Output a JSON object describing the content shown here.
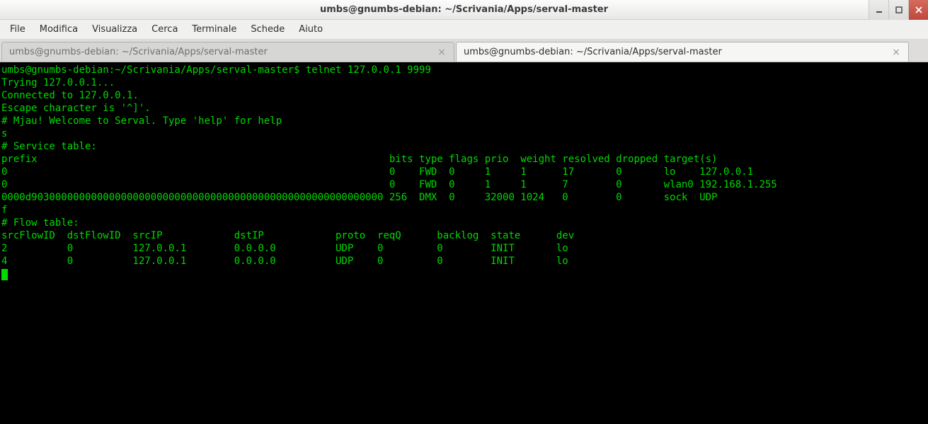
{
  "window": {
    "title": "umbs@gnumbs-debian: ~/Scrivania/Apps/serval-master"
  },
  "menu": {
    "file": "File",
    "edit": "Modifica",
    "view": "Visualizza",
    "search": "Cerca",
    "terminal": "Terminale",
    "tabs": "Schede",
    "help": "Aiuto"
  },
  "tabs": [
    {
      "label": "umbs@gnumbs-debian: ~/Scrivania/Apps/serval-master",
      "active": false
    },
    {
      "label": "umbs@gnumbs-debian: ~/Scrivania/Apps/serval-master",
      "active": true
    }
  ],
  "term": {
    "prompt": "umbs@gnumbs-debian:~/Scrivania/Apps/serval-master$ ",
    "cmd": "telnet 127.0.0.1 9999",
    "l2": "Trying 127.0.0.1...",
    "l3": "Connected to 127.0.0.1.",
    "l4": "Escape character is '^]'.",
    "l5": "# Mjau! Welcome to Serval. Type 'help' for help",
    "l6": "s",
    "l7": "# Service table:",
    "l8": "prefix                                                           bits type flags prio  weight resolved dropped target(s)",
    "l9": "0                                                                0    FWD  0     1     1      17       0       lo    127.0.0.1",
    "l10": "0                                                                0    FWD  0     1     1      7        0       wlan0 192.168.1.255",
    "l11": "0000d90300000000000000000000000000000000000000000000000000000000 256  DMX  0     32000 1024   0        0       sock  UDP",
    "l12": "f",
    "l13": "# Flow table:",
    "l14": "srcFlowID  dstFlowID  srcIP            dstIP            proto  reqQ      backlog  state      dev",
    "l15": "2          0          127.0.0.1        0.0.0.0          UDP    0         0        INIT       lo",
    "l16": "4          0          127.0.0.1        0.0.0.0          UDP    0         0        INIT       lo"
  }
}
